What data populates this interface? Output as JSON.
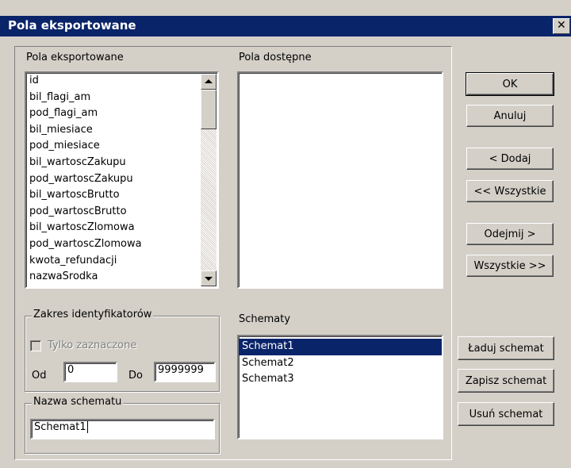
{
  "window": {
    "title": "Pola eksportowane"
  },
  "exported_fields": {
    "label": "Pola eksportowane",
    "items": [
      "id",
      "bil_flagi_am",
      "pod_flagi_am",
      "bil_miesiace",
      "pod_miesiace",
      "bil_wartoscZakupu",
      "pod_wartoscZakupu",
      "bil_wartoscBrutto",
      "pod_wartoscBrutto",
      "bil_wartoscZlomowa",
      "pod_wartoscZlomowa",
      "kwota_refundacji",
      "nazwaSrodka"
    ]
  },
  "available_fields": {
    "label": "Pola dostępne",
    "items": []
  },
  "range_group": {
    "label": "Zakres identyfikatorów",
    "checkbox_label": "Tylko zaznaczone",
    "from_label": "Od",
    "from_value": "0",
    "to_label": "Do",
    "to_value": "9999999"
  },
  "schema_name_group": {
    "label": "Nazwa schematu",
    "value": "Schemat1"
  },
  "schemas": {
    "label": "Schematy",
    "items": [
      "Schemat1",
      "Schemat2",
      "Schemat3"
    ],
    "selected_index": 0
  },
  "buttons": {
    "ok": "OK",
    "cancel": "Anuluj",
    "add": "< Dodaj",
    "add_all": "<< Wszystkie",
    "remove": "Odejmij >",
    "remove_all": "Wszystkie >>",
    "load_schema": "Ładuj schemat",
    "save_schema": "Zapisz schemat",
    "delete_schema": "Usuń schemat"
  },
  "icons": {
    "close": "close-icon",
    "scroll_up": "arrow-up-icon",
    "scroll_down": "arrow-down-icon"
  },
  "colors": {
    "titlebar": "#0a246a",
    "face": "#d4d0c8",
    "selection": "#0a246a"
  }
}
